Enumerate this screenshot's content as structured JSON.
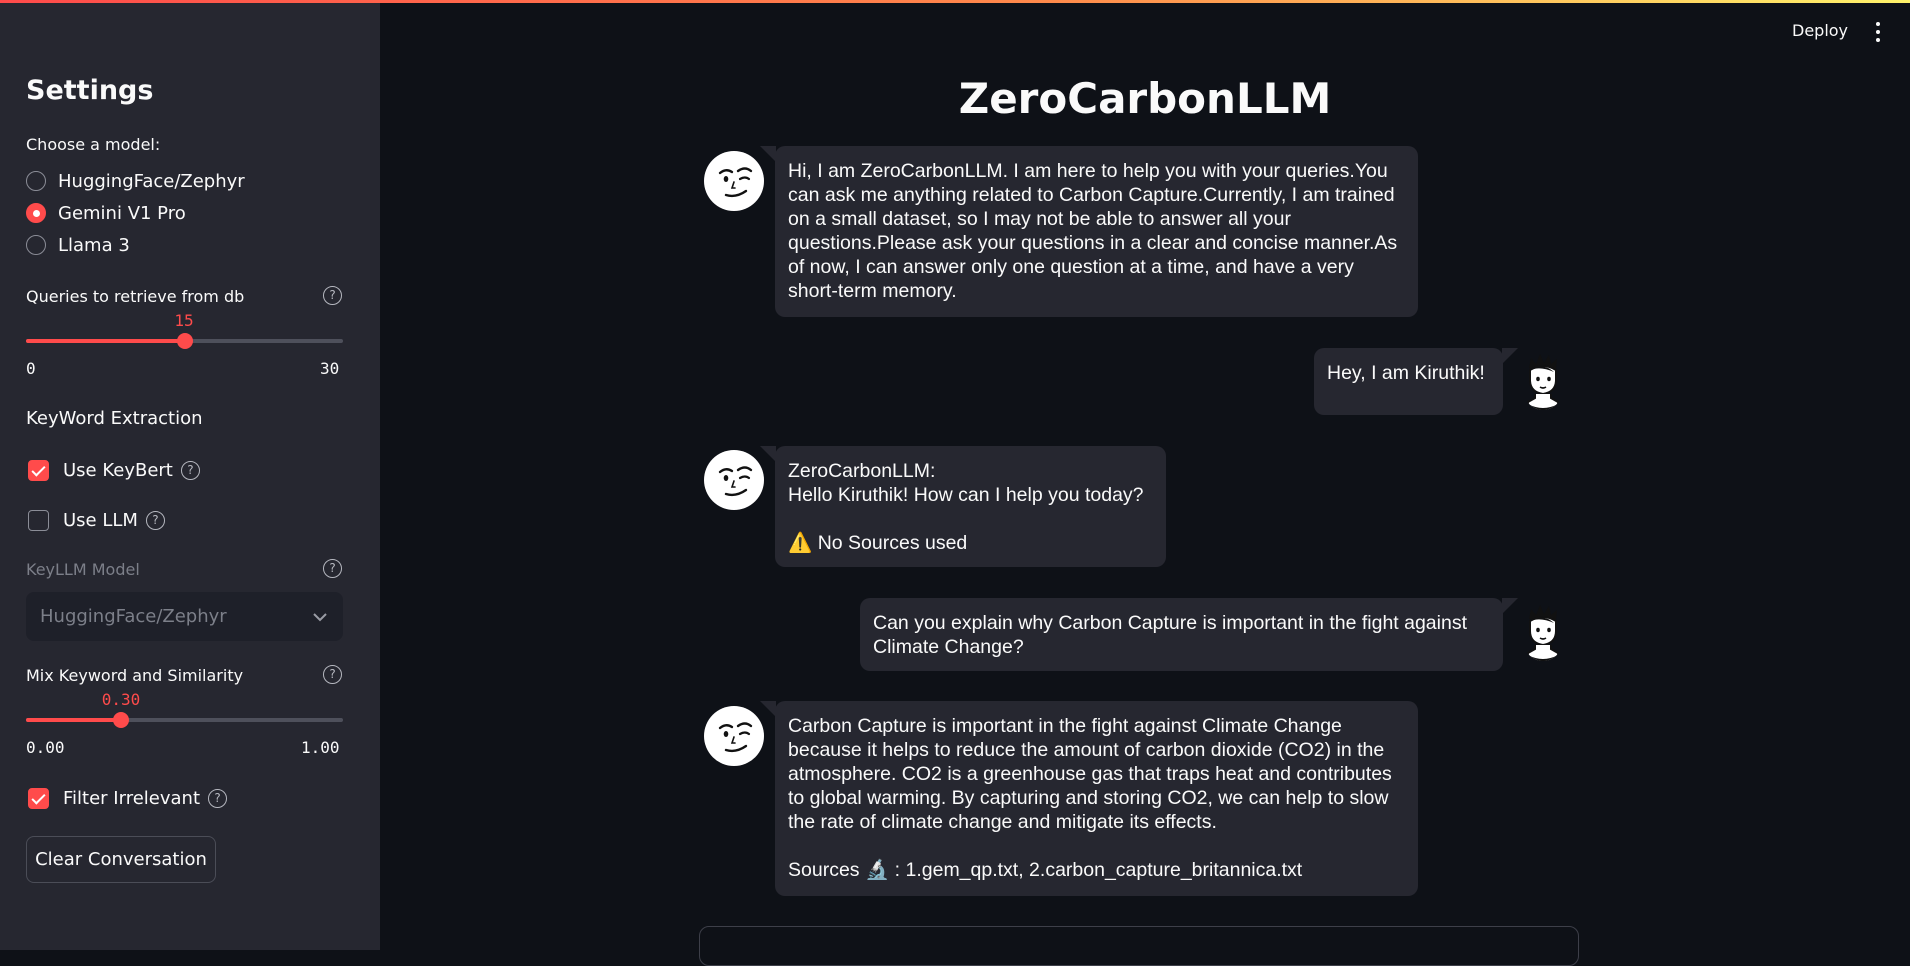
{
  "sidebar": {
    "title": "Settings",
    "model_label": "Choose a model:",
    "models": [
      {
        "label": "HuggingFace/Zephyr",
        "selected": false
      },
      {
        "label": "Gemini V1 Pro",
        "selected": true
      },
      {
        "label": "Llama 3",
        "selected": false
      }
    ],
    "queries_slider": {
      "label": "Queries to retrieve from db",
      "value": "15",
      "min": "0",
      "max": "30",
      "fraction": 0.5
    },
    "keyword_section": "KeyWord Extraction",
    "use_keybert": {
      "label": "Use KeyBert",
      "checked": true
    },
    "use_llm": {
      "label": "Use LLM",
      "checked": false
    },
    "keyllm_model": {
      "label": "KeyLLM Model",
      "value": "HuggingFace/Zephyr"
    },
    "mix_slider": {
      "label": "Mix Keyword and Similarity",
      "value": "0.30",
      "min": "0.00",
      "max": "1.00",
      "fraction": 0.3
    },
    "filter_irrelevant": {
      "label": "Filter Irrelevant",
      "checked": true
    },
    "clear_button": "Clear Conversation",
    "help_glyph": "?"
  },
  "header": {
    "deploy_label": "Deploy",
    "title": "ZeroCarbonLLM"
  },
  "messages": [
    {
      "role": "assistant",
      "lines": [
        "Hi, I am ZeroCarbonLLM. I am here to help you with your queries.You can ask me anything related to Carbon Capture.Currently, I am trained on a small dataset, so I may not be able to answer all your questions.Please ask your questions in a clear and concise manner.As of now, I can answer only one question at a time, and have a very short-term memory."
      ]
    },
    {
      "role": "user",
      "text": "Hey, I am Kiruthik!"
    },
    {
      "role": "assistant",
      "name": "ZeroCarbonLLM:",
      "text": "Hello Kiruthik! How can I help you today?",
      "footer": "⚠️ No Sources used"
    },
    {
      "role": "user",
      "text": "Can you explain why Carbon Capture is important in the fight against Climate Change?"
    },
    {
      "role": "assistant",
      "text": "Carbon Capture is important in the fight against Climate Change because it helps to reduce the amount of carbon dioxide (CO2) in the atmosphere. CO2 is a greenhouse gas that traps heat and contributes to global warming. By capturing and storing CO2, we can help to slow the rate of climate change and mitigate its effects.",
      "footer": "Sources 🔬 : 1.gem_qp.txt, 2.carbon_capture_britannica.txt"
    }
  ],
  "colors": {
    "accent": "#ff4b4b",
    "background": "#0e1117",
    "sidebar": "#262730",
    "bubble": "#262730"
  }
}
